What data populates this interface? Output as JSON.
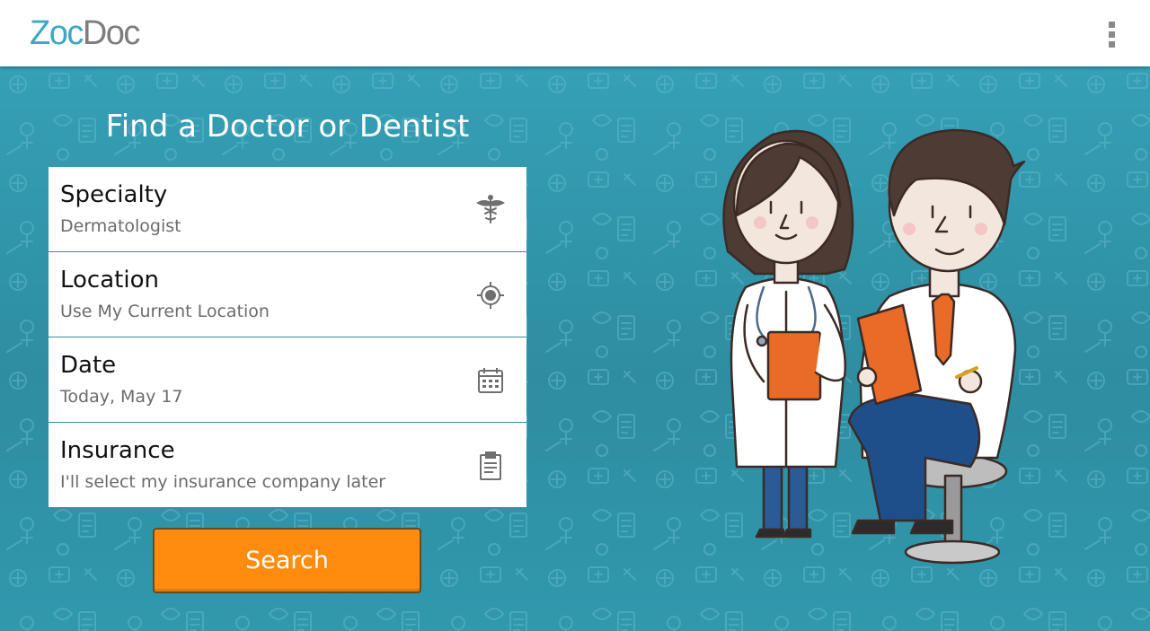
{
  "app": {
    "logo_part1": "Zoc",
    "logo_part2": "Doc",
    "brand_color": "#3fa7c2",
    "overflow_icon": "more-vert-icon"
  },
  "main": {
    "title": "Find a Doctor or Dentist",
    "form": {
      "specialty": {
        "label": "Specialty",
        "value": "Dermatologist",
        "icon": "caduceus-icon"
      },
      "location": {
        "label": "Location",
        "value": "Use My Current Location",
        "icon": "gps-location-icon"
      },
      "date": {
        "label": "Date",
        "value": "Today, May 17",
        "icon": "calendar-icon"
      },
      "insurance": {
        "label": "Insurance",
        "value": "I'll select my insurance company later",
        "icon": "clipboard-icon"
      }
    },
    "search_label": "Search",
    "search_color": "#ff8c0f",
    "background_color": "#2f8fa3"
  }
}
